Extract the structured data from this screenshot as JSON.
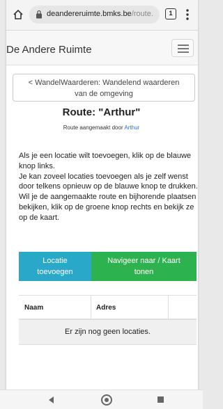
{
  "browser": {
    "url_domain": "deandereruimte.bmks.be",
    "url_path": "/route.",
    "tab_count": "1"
  },
  "site": {
    "brand": "De Andere Ruimte"
  },
  "main": {
    "back_button_line1": "< WandelWaarderen: Wandelend waarderen",
    "back_button_line2": "van de omgeving",
    "title": "Route: \"Arthur\"",
    "subtitle_prefix": "Route aangemaakt door",
    "subtitle_author": "Arthur",
    "instructions": [
      "Als je een locatie wilt toevoegen, klik op de blauwe knop links.",
      "Je kan zoveel locaties toevoegen als je zelf wenst door telkens opnieuw op de blauwe knop te drukken.",
      "Wil je de aangemaakte route en bijhorende plaatsen bekijken, klik op de groene knop rechts en bekijk ze op de kaart."
    ],
    "add_button_line1": "Locatie",
    "add_button_line2": "toevoegen",
    "nav_button_line1": "Navigeer naar / Kaart",
    "nav_button_line2": "tonen",
    "table": {
      "headers": [
        "Naam",
        "Adres",
        ""
      ],
      "empty_message": "Er zijn nog geen locaties."
    }
  },
  "colors": {
    "add_button": "#2aa8c9",
    "nav_button": "#2cb34f",
    "link": "#2b6fd6"
  },
  "icons": {
    "browser_home": "home-icon",
    "lock": "lock-icon",
    "tabs": "tabs-icon",
    "overflow": "overflow-menu-icon",
    "nav_toggle": "hamburger-icon",
    "android_back": "back-triangle-icon",
    "android_home": "home-circle-icon",
    "android_recent": "recent-square-icon"
  }
}
